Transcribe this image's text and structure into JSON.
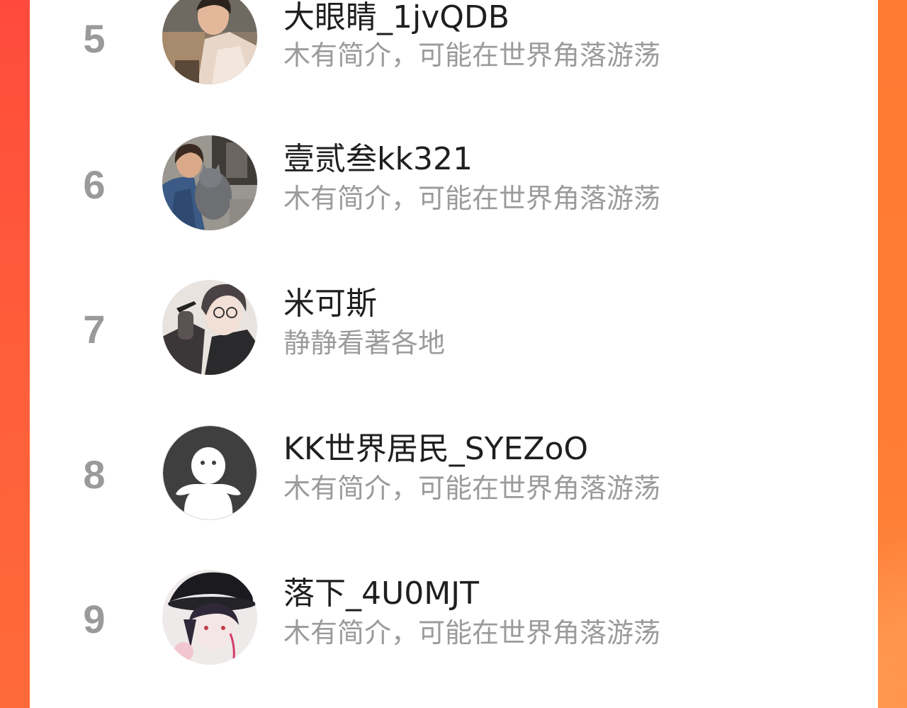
{
  "colors": {
    "accent_left": "#ff4a3d",
    "accent_right": "#ff7d35",
    "name_text": "#1f1f1f",
    "bio_text": "#9b9b9b",
    "rank_text": "#9a9a9a"
  },
  "ranking": {
    "items": [
      {
        "rank": "5",
        "name": "大眼睛_1jvQDB",
        "bio": "木有简介，可能在世界角落游荡",
        "avatar_icon": "avatar-photo-young-man-icon"
      },
      {
        "rank": "6",
        "name": "壹贰叁kk321",
        "bio": "木有简介，可能在世界角落游荡",
        "avatar_icon": "avatar-photo-woman-with-cat-icon"
      },
      {
        "rank": "7",
        "name": "米可斯",
        "bio": "静静看著各地",
        "avatar_icon": "avatar-illustration-anime-boy-icon"
      },
      {
        "rank": "8",
        "name": "KK世界居民_SYEZoO",
        "bio": "木有简介，可能在世界角落游荡",
        "avatar_icon": "default-avatar-ghost-icon"
      },
      {
        "rank": "9",
        "name": "落下_4U0MJT",
        "bio": "木有简介，可能在世界角落游荡",
        "avatar_icon": "avatar-illustration-anime-hat-icon"
      }
    ]
  }
}
